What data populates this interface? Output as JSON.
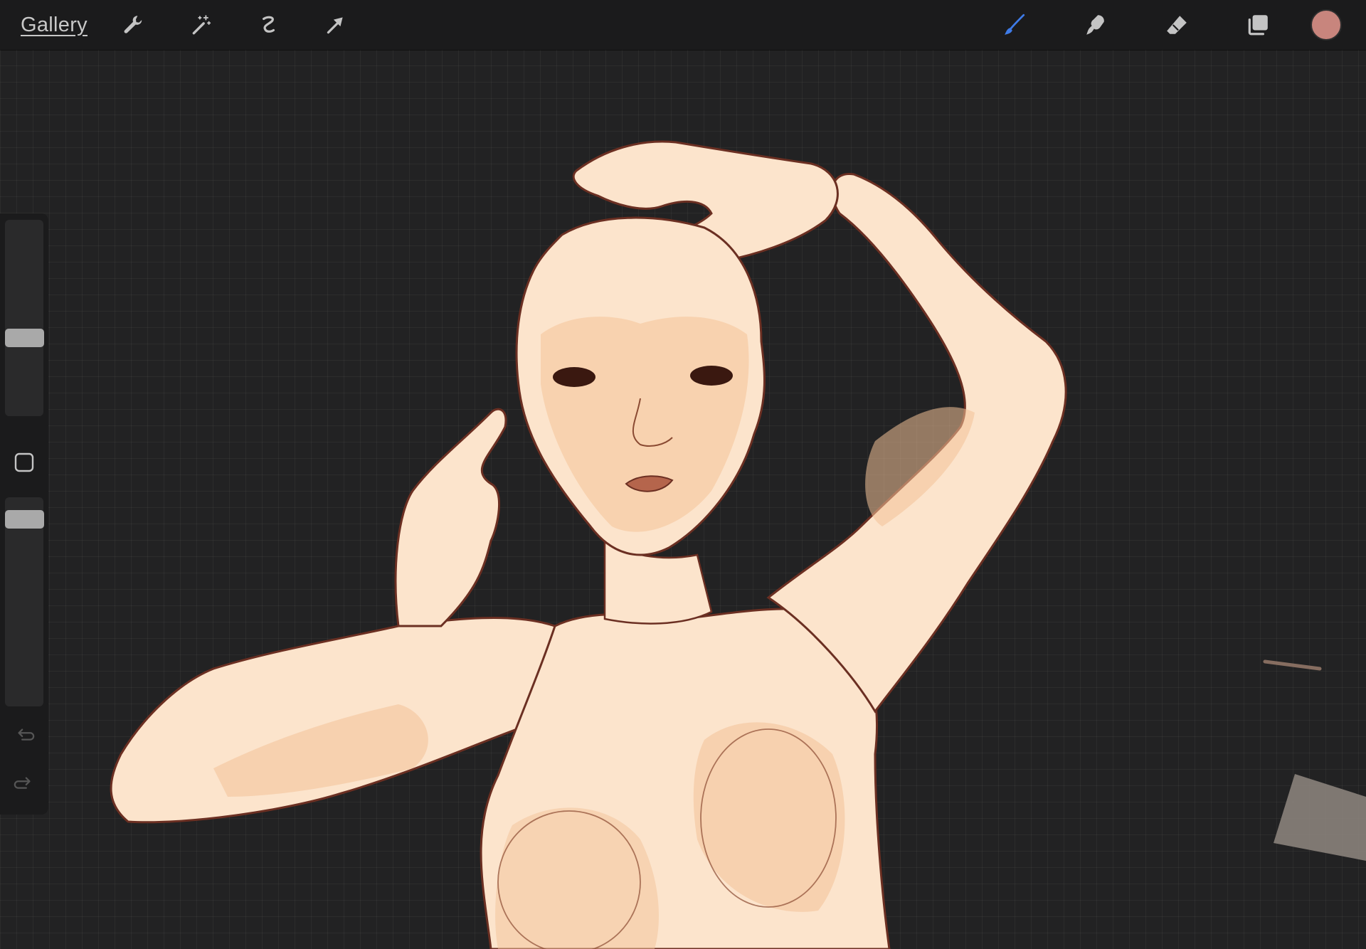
{
  "topbar": {
    "gallery_label": "Gallery",
    "tools_left": [
      {
        "name": "actions",
        "icon": "wrench-icon"
      },
      {
        "name": "adjustments",
        "icon": "magic-wand-icon"
      },
      {
        "name": "selection",
        "icon": "selection-s-icon"
      },
      {
        "name": "transform",
        "icon": "arrow-cursor-icon"
      }
    ],
    "tools_right": [
      {
        "name": "brush",
        "icon": "brush-icon",
        "active": true,
        "color": "#3e7be8"
      },
      {
        "name": "smudge",
        "icon": "smudge-finger-icon",
        "active": false
      },
      {
        "name": "eraser",
        "icon": "eraser-icon",
        "active": false
      },
      {
        "name": "layers",
        "icon": "layers-icon",
        "active": false
      }
    ],
    "current_color": "#c8857d"
  },
  "sidebar": {
    "brush_size_level": 0.57,
    "opacity_level": 0.95,
    "modify_icon": "square-icon",
    "undo_icon": "undo-arrow-icon",
    "redo_icon": "redo-arrow-icon"
  },
  "canvas": {
    "background_color": "#222223",
    "skin_color": "#fce4cc",
    "shadow_color": "#f2c197",
    "line_color": "#6b2f22"
  }
}
